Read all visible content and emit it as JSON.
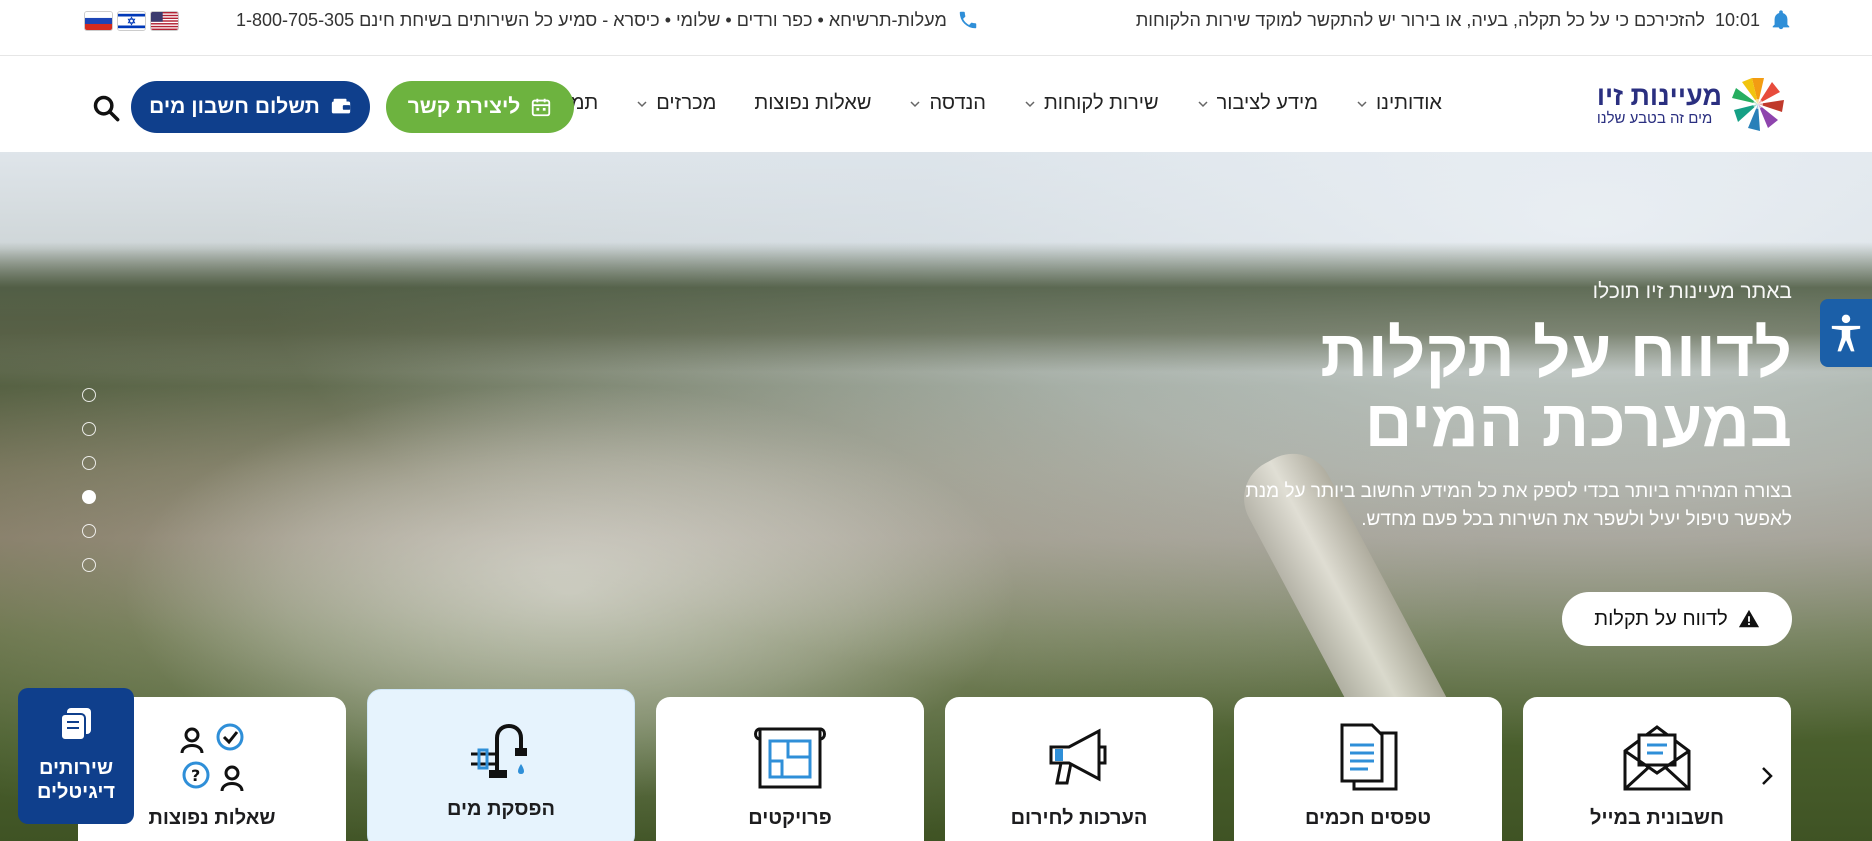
{
  "topbar": {
    "notice_text": "להזכירכם כי על כל תקלה, בעיה, או בירור יש להתקשר למוקד שירות הלקוחות",
    "time": "10:01",
    "phone_label": "מעלות-תרשיחא • כפר ורדים • שלומי • כיסרא - סמיע כל השירותים בשיחת חינם 1-800-705-305",
    "flags": [
      "us",
      "il",
      "ru"
    ]
  },
  "logo": {
    "name": "מעיינות זיו",
    "tagline": "מים זה בטבע שלנו"
  },
  "menu": [
    {
      "label": "אודותינו",
      "has_dropdown": true
    },
    {
      "label": "מידע לציבור",
      "has_dropdown": true
    },
    {
      "label": "שירות לקוחות",
      "has_dropdown": true
    },
    {
      "label": "הנדסה",
      "has_dropdown": true
    },
    {
      "label": "שאלות נפוצות",
      "has_dropdown": false
    },
    {
      "label": "מכרזים",
      "has_dropdown": true
    },
    {
      "label": "תמיכה טכנית",
      "has_dropdown": false
    }
  ],
  "buttons": {
    "contact": "ליצירת קשר",
    "pay": "תשלום חשבון מים"
  },
  "hero": {
    "eyebrow": "באתר מעיינות זיו תוכלו",
    "title": "לדווח על תקלות במערכת המים",
    "description": "בצורה המהירה ביותר בכדי לספק את כל המידע החשוב ביותר על מנת לאפשר טיפול יעיל ולשפר את השירות בכל פעם מחדש.",
    "cta": "לדווח על תקלות",
    "slides_total": 6,
    "active_slide": 4
  },
  "cards": [
    {
      "label": "חשבונית במייל",
      "icon": "envelope-icon"
    },
    {
      "label": "טפסים חכמים",
      "icon": "documents-icon"
    },
    {
      "label": "הערכות לחירום",
      "icon": "megaphone-icon"
    },
    {
      "label": "פרויקטים",
      "icon": "blueprint-icon"
    },
    {
      "label": "הפסקת מים",
      "icon": "faucet-icon"
    },
    {
      "label": "שאלות נפוצות",
      "icon": "faq-people-icon"
    }
  ],
  "digital_services": {
    "label": "שירותים דיגיטלים"
  },
  "colors": {
    "brand_blue": "#0f3f8c",
    "brand_green": "#6db33f",
    "accent_light_blue": "#2f8fd8",
    "card_highlight": "#e6f3fd"
  }
}
